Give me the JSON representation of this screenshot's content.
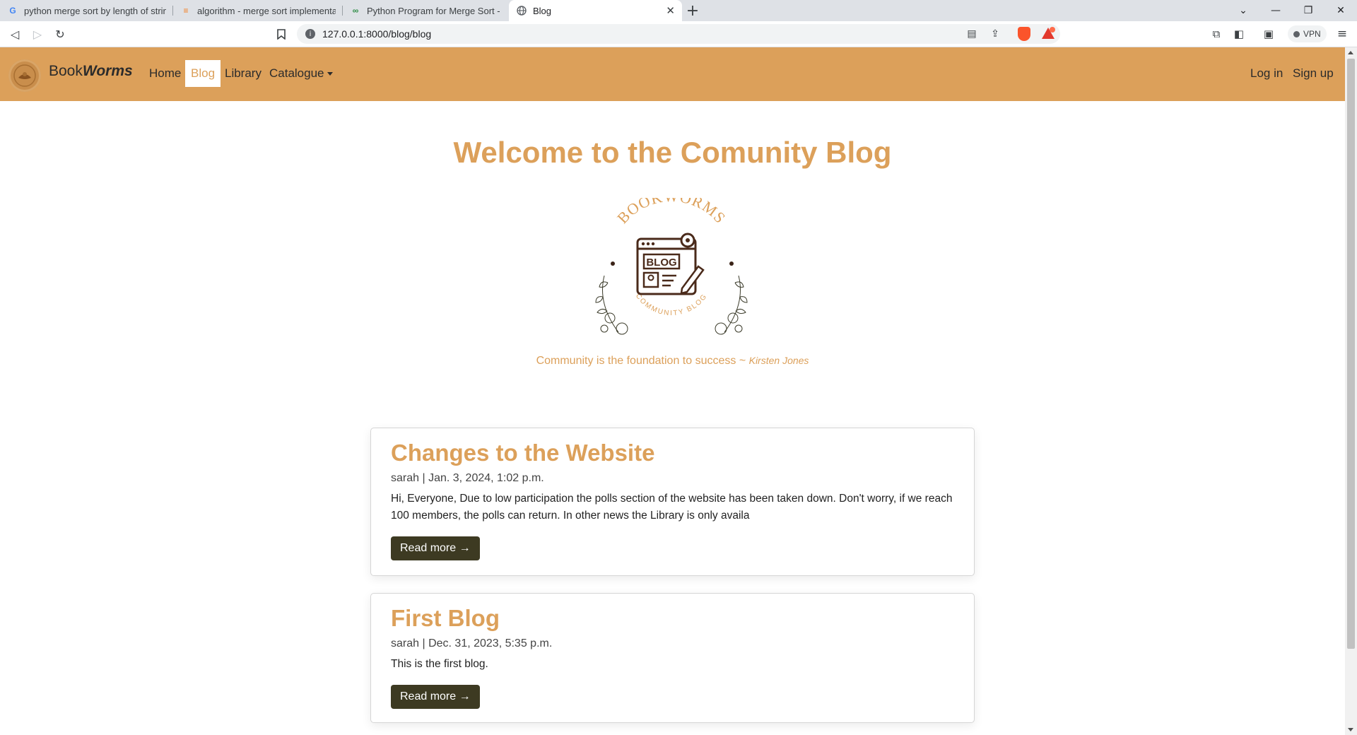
{
  "browser": {
    "tabs": [
      {
        "title": "python merge sort by length of string",
        "icon": "google-icon"
      },
      {
        "title": "algorithm - merge sort implementation",
        "icon": "stackoverflow-icon"
      },
      {
        "title": "Python Program for Merge Sort - Geeks",
        "icon": "geeksforgeeks-icon"
      },
      {
        "title": "Blog",
        "icon": "globe-icon",
        "active": true
      }
    ],
    "url": "127.0.0.1:8000/blog/blog",
    "vpn_label": "VPN"
  },
  "navbar": {
    "brand_plain": "Book",
    "brand_emph": "Worms",
    "links": [
      "Home",
      "Blog",
      "Library",
      "Catalogue"
    ],
    "active_link": "Blog",
    "login": "Log in",
    "signup": "Sign up"
  },
  "hero": {
    "title": "Welcome to the Comunity Blog",
    "logo_text_top": "BOOKWORMS",
    "logo_text_mid": "BLOG",
    "logo_text_bottom": "COMMUNITY BLOG",
    "quote": "Community is the foundation to success ~",
    "quote_author": "Kirsten Jones"
  },
  "posts": [
    {
      "title": "Changes to the Website",
      "meta": "sarah | Jan. 3, 2024, 1:02 p.m.",
      "excerpt": "Hi, Everyone, Due to low participation the polls section of the website has been taken down. Don't worry, if we reach 100 members, the polls can return. In other news the Library is only availa",
      "button": "Read more →"
    },
    {
      "title": "First Blog",
      "meta": "sarah | Dec. 31, 2023, 5:35 p.m.",
      "excerpt": "This is the first blog.",
      "button": "Read more →"
    }
  ],
  "colors": {
    "accent": "#dca05a",
    "button": "#3d3a22"
  }
}
